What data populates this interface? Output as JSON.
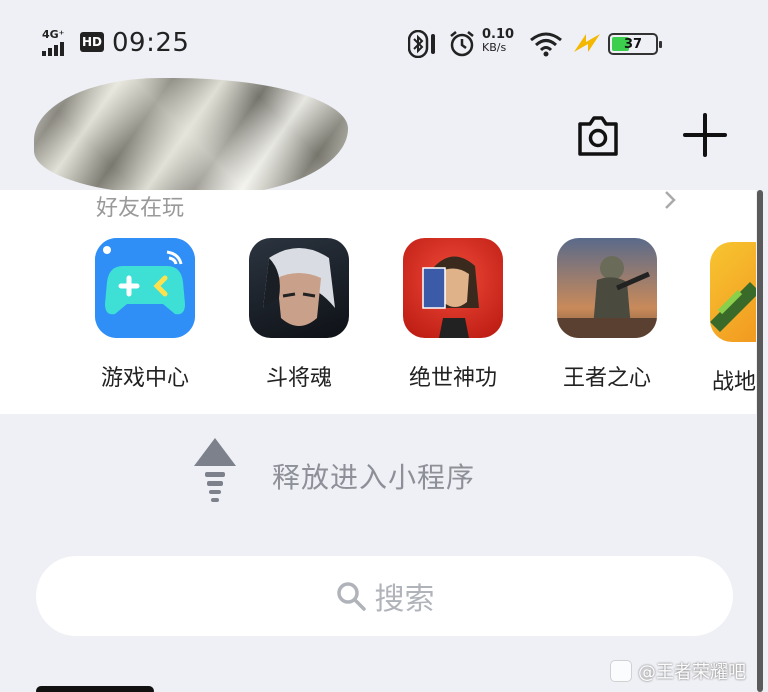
{
  "status_bar": {
    "network": "4G⁺",
    "hd": "HD",
    "time": "09:25",
    "speed_value": "0.10",
    "speed_unit": "KB/s",
    "battery": "37",
    "battery_color": "#3ccf4e"
  },
  "header": {
    "camera_icon": "camera-icon",
    "plus_icon": "plus-icon"
  },
  "friends": {
    "title": "好友在玩",
    "games": [
      {
        "label": "游戏中心",
        "icon": "game-center-icon"
      },
      {
        "label": "斗将魂",
        "icon": "doujianghun-icon"
      },
      {
        "label": "绝世神功",
        "icon": "jueshishengong-icon"
      },
      {
        "label": "王者之心",
        "icon": "wangzhezhixin-icon"
      },
      {
        "label": "战地",
        "icon": "zhandi-icon"
      }
    ]
  },
  "pull_hint": "释放进入小程序",
  "search": {
    "placeholder": "搜索"
  },
  "watermark": "@王者荣耀吧"
}
